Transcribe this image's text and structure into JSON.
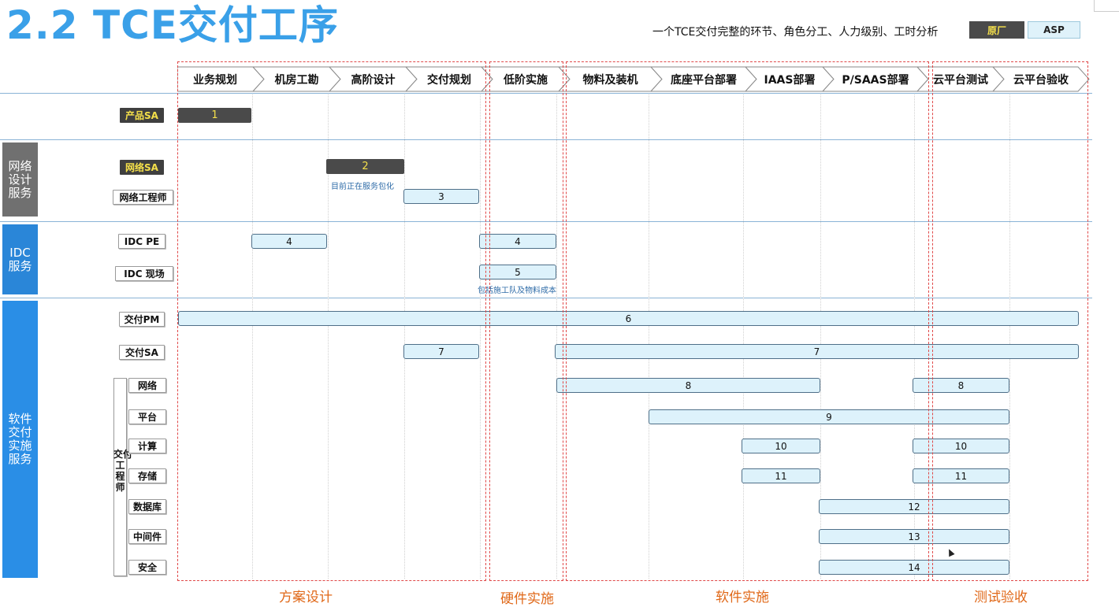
{
  "title": "2.2 TCE交付工序",
  "subtitle": "一个TCE交付完整的环节、角色分工、人力级别、工时分析",
  "legend": {
    "vendor": "原厂",
    "asp": "ASP"
  },
  "phases": [
    "业务规划",
    "机房工勘",
    "高阶设计",
    "交付规划",
    "低阶实施",
    "物料及装机",
    "底座平台部署",
    "IAAS部署",
    "P/SAAS部署",
    "云平台测试",
    "云平台验收"
  ],
  "groups": {
    "network": "网络\n设计\n服务",
    "idc": "IDC\n服务",
    "software": "软件\n交付\n实施\n服务"
  },
  "roles": {
    "product_sa": "产品SA",
    "network_sa": "网络SA",
    "network_engineer": "网络工程师",
    "idc_pe": "IDC PE",
    "idc_onsite": "IDC 现场",
    "delivery_pm": "交付PM",
    "delivery_sa": "交付SA",
    "delivery_engineer": "交付\n工\n程\n师",
    "eng_network": "网络",
    "eng_platform": "平台",
    "eng_compute": "计算",
    "eng_storage": "存储",
    "eng_database": "数据库",
    "eng_middleware": "中间件",
    "eng_security": "安全"
  },
  "bars": {
    "b1": "1",
    "b2": "2",
    "b3": "3",
    "b4a": "4",
    "b4b": "4",
    "b5": "5",
    "b6": "6",
    "b7a": "7",
    "b7b": "7",
    "b8a": "8",
    "b8b": "8",
    "b9": "9",
    "b10a": "10",
    "b10b": "10",
    "b11a": "11",
    "b11b": "11",
    "b12": "12",
    "b13": "13",
    "b14": "14"
  },
  "notes": {
    "network_sa": "目前正在服务包化",
    "idc_onsite": "包括施工队及物料成本"
  },
  "stages": {
    "design": "方案设计",
    "hardware": "硬件实施",
    "software": "软件实施",
    "testing": "测试验收"
  }
}
